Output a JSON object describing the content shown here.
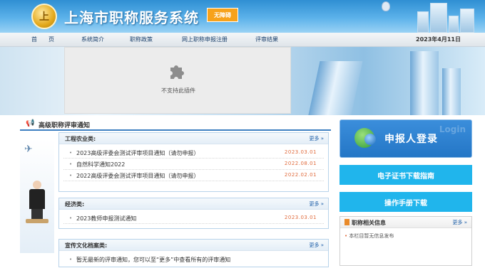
{
  "header": {
    "title": "上海市职称服务系统",
    "accessible_label": "无障碍"
  },
  "nav": {
    "items": [
      "首　　页",
      "系统简介",
      "职称政策",
      "网上职称申报注册",
      "评审结果"
    ],
    "date": "2023年4月11日"
  },
  "banner": {
    "plugin_message": "不支持此插件"
  },
  "notices": {
    "section_title": "高级职称评审通知",
    "groups": [
      {
        "title": "工程农业类:",
        "more": "更多",
        "items": [
          {
            "text": "2023高级评委会测试评审项目通知（请勿申报）",
            "date": "2023.03.01"
          },
          {
            "text": "自然科学通知2022",
            "date": "2022.08.01"
          },
          {
            "text": "2022高级评委会测试评审项目通知（请勿申报）",
            "date": "2022.02.01"
          }
        ]
      },
      {
        "title": "经济类:",
        "more": "更多",
        "items": [
          {
            "text": "2023教师申报测试通知",
            "date": "2023.03.01"
          }
        ]
      },
      {
        "title": "宣传文化档案类:",
        "more": "更多",
        "items": [
          {
            "text": "暂无最新的评审通知，您可以至“更多”中查看所有的评审通知",
            "date": ""
          }
        ]
      }
    ]
  },
  "sidebar": {
    "login_label": "申报人登录",
    "login_watermark": "Login",
    "cert_guide_label": "电子证书下载指南",
    "manual_label": "操作手册下载",
    "info": {
      "title": "职称相关信息",
      "more": "更多",
      "message": "本栏目暂无信息发布"
    }
  },
  "colors": {
    "header_blue": "#2f8fd3",
    "accent_cyan": "#20b5ec",
    "date_orange": "#e06a3b",
    "link_blue": "#1e5fa8"
  }
}
